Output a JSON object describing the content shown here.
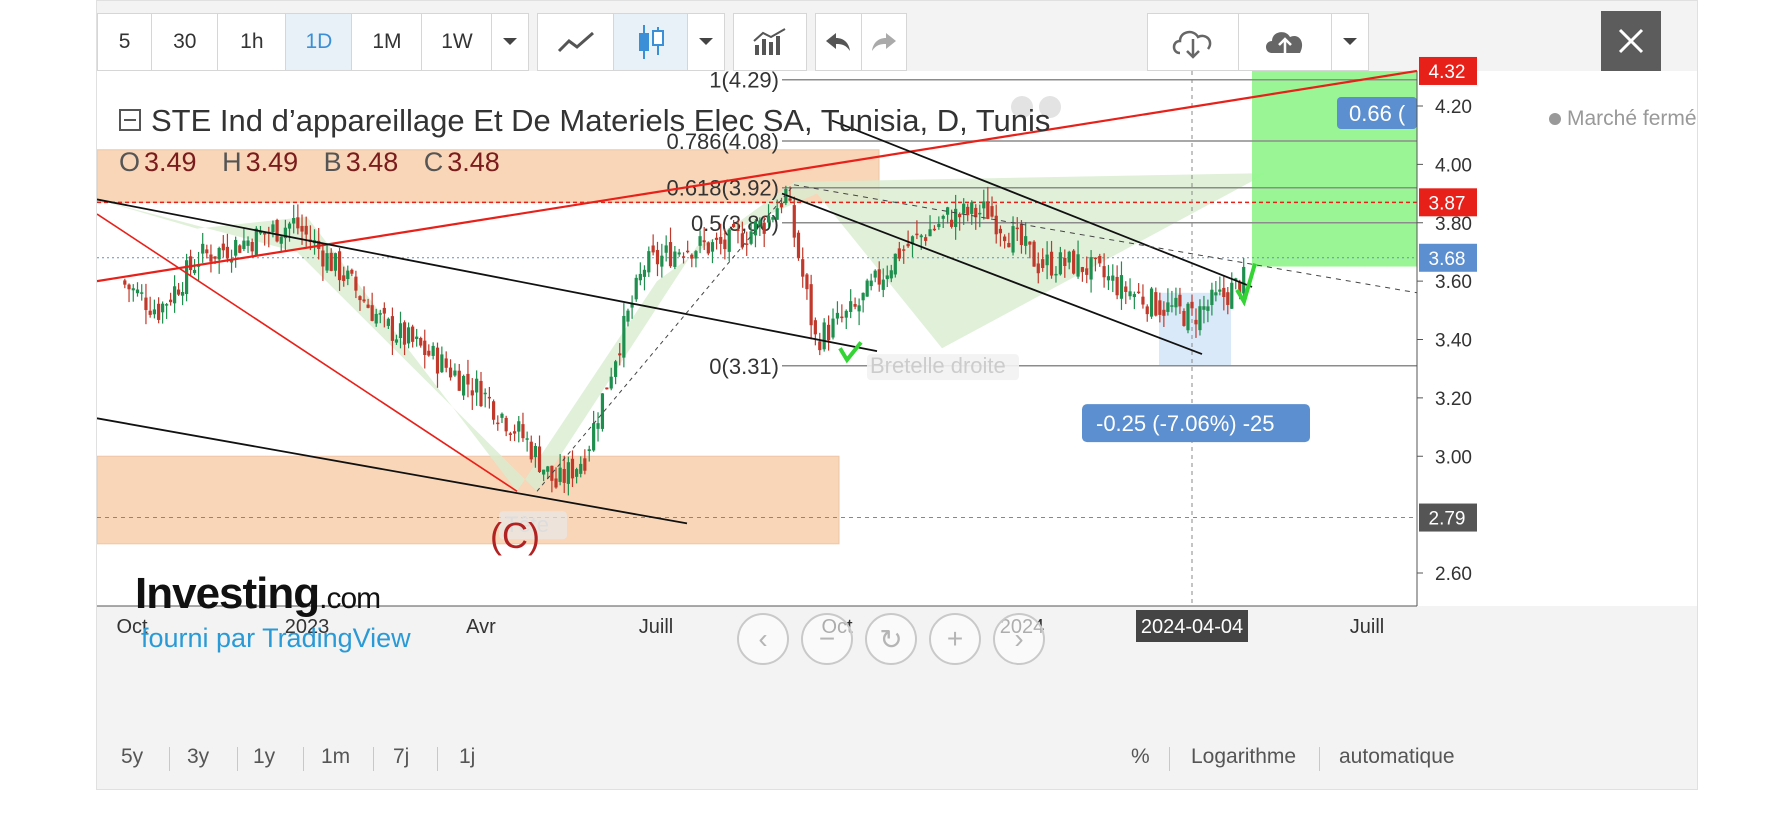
{
  "toolbar": {
    "intervals": [
      "5",
      "30",
      "1h",
      "1D",
      "1M",
      "1W"
    ],
    "active_interval": "1D",
    "icons": [
      "chevron-down-icon",
      "line-chart-icon",
      "candlestick-icon",
      "chevron-down-icon",
      "indicators-icon",
      "undo-icon",
      "redo-icon",
      "cloud-download-icon",
      "cloud-upload-icon",
      "chevron-down-icon",
      "close-icon"
    ]
  },
  "legend": {
    "title": "STE Ind d’appareillage Et De Materiels Elec SA, Tunisia, D, Tunis",
    "ohlc": [
      {
        "key": "O",
        "value": "3.49"
      },
      {
        "key": "H",
        "value": "3.49"
      },
      {
        "key": "B",
        "value": "3.48"
      },
      {
        "key": "C",
        "value": "3.48"
      }
    ]
  },
  "branding": {
    "logo_main": "Investing",
    "logo_suffix": ".com",
    "provided_by": "fourni par TradingView"
  },
  "status": {
    "market": "Marché fermé"
  },
  "bottom_bar": {
    "ranges": [
      "5y",
      "3y",
      "1y",
      "1m",
      "7j",
      "1j"
    ],
    "right_options": [
      "%",
      "Logarithme",
      "automatique"
    ]
  },
  "zoom_controls": [
    "chevron-left-icon",
    "zoom-out-icon",
    "reset-icon",
    "zoom-in-icon",
    "chevron-right-icon"
  ],
  "colors": {
    "up": "#1e8f4e",
    "down": "#c0392b",
    "trend_red": "#e8201a",
    "zone_orange": "#f6c9a0",
    "zone_green_fill": "#d8ecd0",
    "target_green": "#8ff58a",
    "price_label_blue": "#5b8fd0"
  },
  "chart_data": {
    "type": "candlestick",
    "y_axis": {
      "ticks": [
        "4.20",
        "4.00",
        "3.80",
        "3.60",
        "3.40",
        "3.20",
        "3.00",
        "2.60"
      ],
      "range": [
        2.55,
        4.3
      ]
    },
    "x_axis": {
      "ticks": [
        "Oct",
        "2023",
        "Avr",
        "Juill",
        "Oct",
        "2024",
        "2024-04-04",
        "Juill"
      ],
      "crosshair_label": "2024-04-04"
    },
    "price_labels": [
      {
        "text": "4.32",
        "value": 4.32,
        "color": "#e8201a"
      },
      {
        "text": "3.87",
        "value": 3.87,
        "color": "#e8201a"
      },
      {
        "text": "3.68",
        "value": 3.68,
        "color": "#5b8fd0"
      },
      {
        "text": "2.79",
        "value": 2.79,
        "color": "#555555"
      }
    ],
    "fibonacci": [
      {
        "label": "1(4.29)",
        "value": 4.29
      },
      {
        "label": "0.786(4.08)",
        "value": 4.08
      },
      {
        "label": "0.618(3.92)",
        "value": 3.92
      },
      {
        "label": "0.5(3,80)",
        "value": 3.8
      },
      {
        "label": "0(3.31)",
        "value": 3.31
      }
    ],
    "annotations": [
      {
        "text": "Bretelle droite"
      },
      {
        "text": "Tête"
      },
      {
        "text": "(C)"
      },
      {
        "text": "-0.25 (-7.06%) -25"
      },
      {
        "text": "0.66 ("
      }
    ],
    "series": [
      {
        "date": "2022-09-25",
        "close": 3.6
      },
      {
        "date": "2022-10-15",
        "close": 3.5
      },
      {
        "date": "2022-11-05",
        "close": 3.68
      },
      {
        "date": "2022-12-01",
        "close": 3.74
      },
      {
        "date": "2022-12-25",
        "close": 3.8
      },
      {
        "date": "2023-01-20",
        "close": 3.62
      },
      {
        "date": "2023-02-10",
        "close": 3.45
      },
      {
        "date": "2023-03-05",
        "close": 3.35
      },
      {
        "date": "2023-04-01",
        "close": 3.22
      },
      {
        "date": "2023-04-25",
        "close": 3.05
      },
      {
        "date": "2023-05-10",
        "close": 2.9
      },
      {
        "date": "2023-05-25",
        "close": 3.0
      },
      {
        "date": "2023-06-10",
        "close": 3.35
      },
      {
        "date": "2023-06-25",
        "close": 3.65
      },
      {
        "date": "2023-07-15",
        "close": 3.72
      },
      {
        "date": "2023-08-05",
        "close": 3.72
      },
      {
        "date": "2023-08-25",
        "close": 3.8
      },
      {
        "date": "2023-09-05",
        "close": 3.9
      },
      {
        "date": "2023-09-20",
        "close": 3.4
      },
      {
        "date": "2023-10-10",
        "close": 3.5
      },
      {
        "date": "2023-11-01",
        "close": 3.7
      },
      {
        "date": "2023-11-25",
        "close": 3.82
      },
      {
        "date": "2023-12-15",
        "close": 3.84
      },
      {
        "date": "2024-01-10",
        "close": 3.66
      },
      {
        "date": "2024-02-01",
        "close": 3.66
      },
      {
        "date": "2024-02-25",
        "close": 3.58
      },
      {
        "date": "2024-03-15",
        "close": 3.52
      },
      {
        "date": "2024-04-04",
        "close": 3.48
      },
      {
        "date": "2024-04-20",
        "close": 3.55
      },
      {
        "date": "2024-04-30",
        "close": 3.6
      }
    ]
  }
}
